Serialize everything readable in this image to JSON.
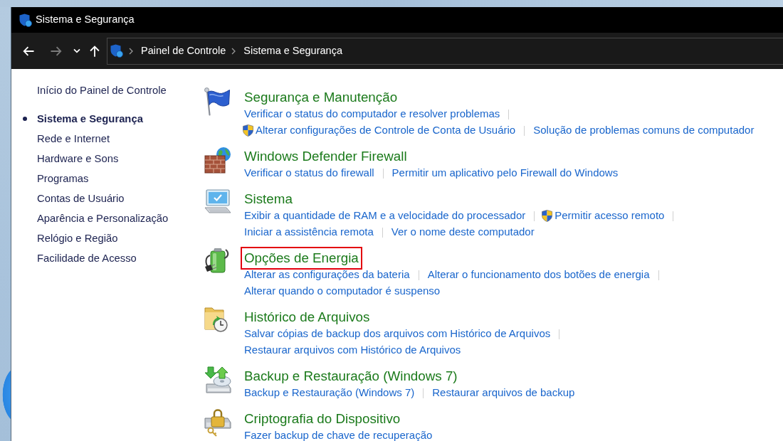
{
  "window": {
    "title": "Sistema e Segurança"
  },
  "nav_buttons": [
    {
      "kind": "back",
      "disabled": false
    },
    {
      "kind": "forward",
      "disabled": true
    },
    {
      "kind": "recent",
      "disabled": false
    },
    {
      "kind": "up",
      "disabled": false
    }
  ],
  "breadcrumb": [
    "Painel de Controle",
    "Sistema e Segurança"
  ],
  "sidebar": {
    "home": "Início do Painel de Controle",
    "items": [
      {
        "label": "Sistema e Segurança",
        "selected": true
      },
      {
        "label": "Rede e Internet",
        "selected": false
      },
      {
        "label": "Hardware e Sons",
        "selected": false
      },
      {
        "label": "Programas",
        "selected": false
      },
      {
        "label": "Contas de Usuário",
        "selected": false
      },
      {
        "label": "Aparência e Personalização",
        "selected": false
      },
      {
        "label": "Relógio e Região",
        "selected": false
      },
      {
        "label": "Facilidade de Acesso",
        "selected": false
      }
    ]
  },
  "sections": [
    {
      "title": "Segurança e Manutenção",
      "highlighted": false,
      "link_lines": [
        [
          {
            "text": "Verificar o status do computador e resolver problemas",
            "shield": false
          }
        ],
        [
          {
            "text": "Alterar configurações de Controle de Conta de Usuário",
            "shield": true
          },
          {
            "text": "Solução de problemas comuns de computador",
            "shield": false
          }
        ]
      ]
    },
    {
      "title": "Windows Defender Firewall",
      "highlighted": false,
      "link_lines": [
        [
          {
            "text": "Verificar o status do firewall",
            "shield": false
          },
          {
            "text": "Permitir um aplicativo pelo Firewall do Windows",
            "shield": false
          }
        ]
      ]
    },
    {
      "title": "Sistema",
      "highlighted": false,
      "link_lines": [
        [
          {
            "text": "Exibir a quantidade de RAM e a velocidade do processador",
            "shield": false
          },
          {
            "text": "Permitir acesso remoto",
            "shield": true
          }
        ],
        [
          {
            "text": "Iniciar a assistência remota",
            "shield": false
          },
          {
            "text": "Ver o nome deste computador",
            "shield": false
          }
        ]
      ]
    },
    {
      "title": "Opções de Energia",
      "highlighted": true,
      "link_lines": [
        [
          {
            "text": "Alterar as configurações da bateria",
            "shield": false
          },
          {
            "text": "Alterar o funcionamento dos botões de energia",
            "shield": false
          }
        ],
        [
          {
            "text": "Alterar quando o computador é suspenso",
            "shield": false
          }
        ]
      ]
    },
    {
      "title": "Histórico de Arquivos",
      "highlighted": false,
      "link_lines": [
        [
          {
            "text": "Salvar cópias de backup dos arquivos com Histórico de Arquivos",
            "shield": false
          }
        ],
        [
          {
            "text": "Restaurar arquivos com Histórico de Arquivos",
            "shield": false
          }
        ]
      ]
    },
    {
      "title": "Backup e Restauração (Windows 7)",
      "highlighted": false,
      "link_lines": [
        [
          {
            "text": "Backup e Restauração (Windows 7)",
            "shield": false
          },
          {
            "text": "Restaurar arquivos de backup",
            "shield": false
          }
        ]
      ]
    },
    {
      "title": "Criptografia do Dispositivo",
      "highlighted": false,
      "link_lines": [
        [
          {
            "text": "Fazer backup de chave de recuperação",
            "shield": false
          }
        ]
      ]
    }
  ]
}
